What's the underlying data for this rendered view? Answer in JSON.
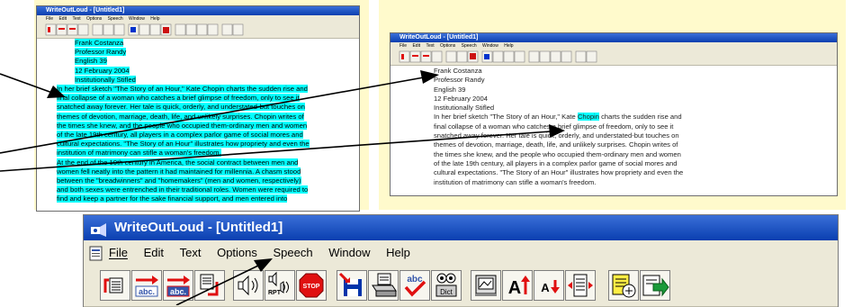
{
  "app": {
    "title": "WriteOutLoud - [Untitled1]"
  },
  "menu": {
    "items": [
      {
        "label": "File"
      },
      {
        "label": "Edit"
      },
      {
        "label": "Text"
      },
      {
        "label": "Options"
      },
      {
        "label": "Speech"
      },
      {
        "label": "Window"
      },
      {
        "label": "Help"
      }
    ]
  },
  "document": {
    "lines_left": [
      "Frank Costanza",
      "Professor Randy",
      "English 39",
      "12 February 2004",
      "Institutionally Stifled",
      "In her brief sketch \"The Story of an Hour,\" Kate Chopin charts the sudden rise and",
      "final collapse of a woman who catches a brief glimpse of freedom, only to see it",
      "snatched away forever. Her tale is quick, orderly, and understated-but touches on",
      "themes of devotion, marriage, death, life, and unlikely surprises. Chopin writes of",
      "the times she knew, and the people who occupied them-ordinary men and women",
      "of the late 19th century, all players in a complex parlor game of social mores and",
      "cultural expectations. \"The Story of an Hour\" illustrates how propriety and even the",
      "institution of matrimony can stifle a woman's freedom.",
      "At the end of the 19th century in America, the social contract between men and",
      "women fell neatly into the pattern it had maintained for millennia. A chasm stood",
      "between the \"breadwinners\" and \"homemakers\" (men and women, respectively)",
      "and both sexes were entrenched in their traditional roles. Women were required to",
      "find and keep a partner for the sake financial support, and men entered into"
    ],
    "lines_right": [
      "Frank Costanza",
      "Professor Randy",
      "English 39",
      "12 February 2004",
      "Institutionally Stifled",
      "In her brief sketch \"The Story of an Hour,\" Kate Chopin charts the sudden rise and",
      "final collapse of a woman who catches a brief glimpse of freedom, only to see it",
      "snatched away forever. Her tale is quick, orderly, and understated-but touches on",
      "themes of devotion, marriage, death, life, and unlikely surprises. Chopin writes of",
      "the times she knew, and the people who occupied them-ordinary men and women",
      "of the late 19th century, all players in a complex parlor game of social mores and",
      "cultural expectations. \"The Story of an Hour\" illustrates how propriety and even the",
      "institution of matrimony can stifle a woman's freedom."
    ],
    "highlighted_word": "Chopin"
  },
  "toolbar": {
    "abc_label": "abc.",
    "rpt_label": "RPT",
    "stop_label": "STOP",
    "dict_label": "Dict",
    "spell_label": "abc"
  },
  "colors": {
    "panel": "#fffacc",
    "highlight": "#00ffff",
    "titlebar": "#0a3fb0",
    "arrow": "#000000"
  }
}
